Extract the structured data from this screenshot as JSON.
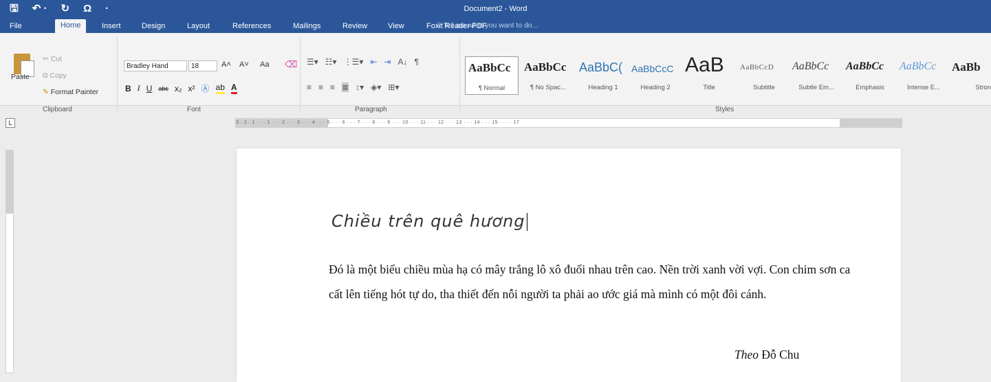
{
  "window": {
    "title": "Document2 - Word"
  },
  "qat": {
    "save_glyph": "🖫",
    "undo_glyph": "↶ ·",
    "redo_glyph": "↻",
    "symbol_glyph": "Ω",
    "more_glyph": "·"
  },
  "tabs": [
    "File",
    "Home",
    "Insert",
    "Design",
    "Layout",
    "References",
    "Mailings",
    "Review",
    "View",
    "Foxit Reader PDF"
  ],
  "tell_me": "Tell me what you want to do...",
  "clipboard": {
    "paste": "Paste",
    "cut": "Cut",
    "copy": "Copy",
    "format_painter": "Format Painter",
    "group": "Clipboard"
  },
  "font": {
    "name": "Bradley Hand",
    "size": "18",
    "group": "Font",
    "bold": "B",
    "italic": "I",
    "underline": "U",
    "strike": "abc",
    "subscript": "x₂",
    "superscript": "x²",
    "grow": "A˄",
    "shrink": "A˅",
    "case": "Aa",
    "highlight": "ab",
    "color": "A"
  },
  "paragraph": {
    "group": "Paragraph",
    "sort": "A↓",
    "pilcrow": "¶"
  },
  "styles": {
    "group": "Styles",
    "items": [
      {
        "sample": "AaBbCc",
        "label": "¶ Normal"
      },
      {
        "sample": "AaBbCc",
        "label": "¶ No Spac..."
      },
      {
        "sample": "AaBbC(",
        "label": "Heading 1"
      },
      {
        "sample": "AaBbCcC",
        "label": "Heading 2"
      },
      {
        "sample": "AaB",
        "label": "Title"
      },
      {
        "sample": "AaBbCcD",
        "label": "Subtitle"
      },
      {
        "sample": "AaBbCc",
        "label": "Subtle Em..."
      },
      {
        "sample": "AaBbCc",
        "label": "Emphasis"
      },
      {
        "sample": "AaBbCc",
        "label": "Intense E..."
      },
      {
        "sample": "AaBb",
        "label": "Stron"
      }
    ]
  },
  "ruler": {
    "corner": "L",
    "ticks": "3 · 2 · 1 · · · 1 · · · 2 · · · 3 · · · 4 · · · 5 · · · 6 · · · 7 · · · 8 · · · 9 · · · 10 · · · 11 · · · 12 · · · 13 · · · 14 · · · 15 · · · · 17"
  },
  "document": {
    "heading": "Chiều trên quê hương",
    "body": "Đó là một biểu chiều mùa hạ có mây trắng lô xô đuổi nhau trên cao. Nền trời xanh vời vợi. Con chim sơn ca cất lên tiếng hót tự do, tha thiết đến nỗi người ta phải ao ước giá mà mình có một đôi cánh.",
    "attribution_prefix": "Theo",
    "attribution_author": "Đỗ Chu"
  }
}
